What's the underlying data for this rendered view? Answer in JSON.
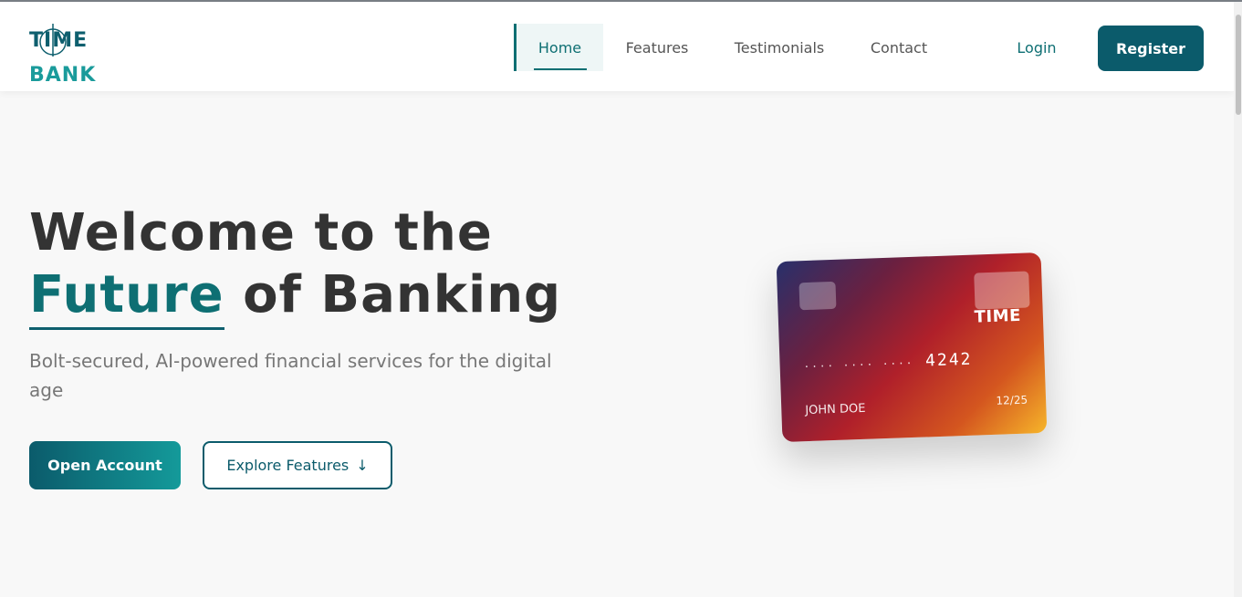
{
  "header": {
    "logo_line1": "TIME",
    "logo_line2": "BANK",
    "nav": [
      "Home",
      "Features",
      "Testimonials",
      "Contact"
    ],
    "login_label": "Login",
    "register_label": "Register"
  },
  "hero": {
    "title_line1": "Welcome to the",
    "title_accent": "Future",
    "title_rest": "of Banking",
    "subtitle": "Bolt-secured, AI-powered financial services for the digital age",
    "open_account_label": "Open Account",
    "explore_label": "Explore Features",
    "explore_icon": "↓"
  },
  "card": {
    "brand": "TIME",
    "masked": "····  ····  ····",
    "last4": "4242",
    "holder": "JOHN DOE",
    "expiry": "12/25"
  },
  "colors": {
    "accent": "#0e6f73",
    "primary_button": "#0b5b6b",
    "background": "#f8f8f8"
  }
}
